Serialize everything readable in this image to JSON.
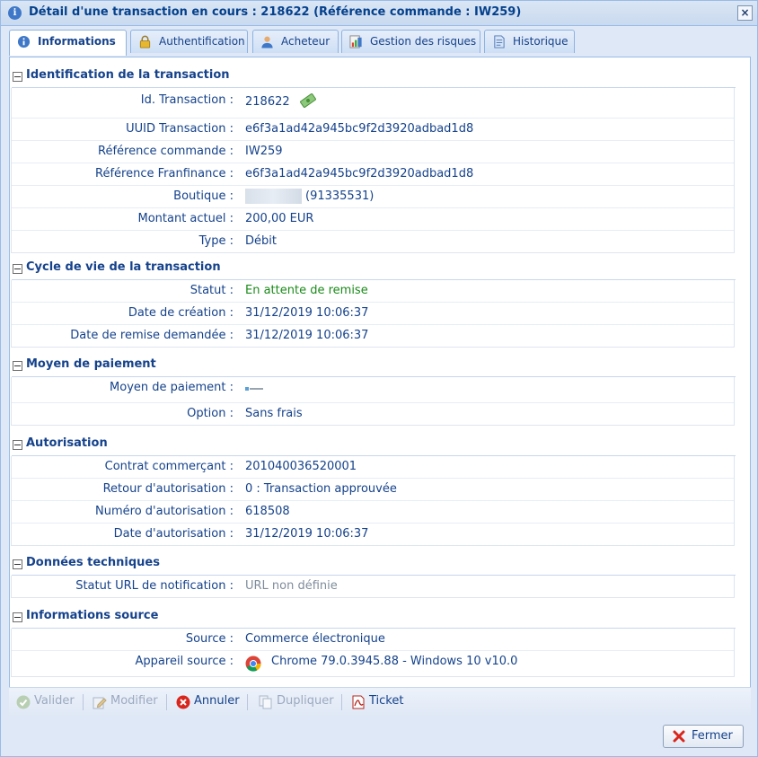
{
  "window": {
    "title": "Détail d'une transaction en cours : 218622 (Référence commande : IW259)",
    "close_symbol": "×"
  },
  "tabs": [
    {
      "label": "Informations",
      "active": true,
      "icon": "info-icon"
    },
    {
      "label": "Authentification",
      "active": false,
      "icon": "lock-icon"
    },
    {
      "label": "Acheteur",
      "active": false,
      "icon": "user-icon"
    },
    {
      "label": "Gestion des risques",
      "active": false,
      "icon": "risk-chart-icon"
    },
    {
      "label": "Historique",
      "active": false,
      "icon": "document-icon"
    }
  ],
  "sections": {
    "identification": {
      "title": "Identification de la transaction",
      "rows": [
        {
          "label": "Id. Transaction :",
          "value": "218622"
        },
        {
          "label": "UUID Transaction :",
          "value": "e6f3a1ad42a945bc9f2d3920adbad1d8"
        },
        {
          "label": "Référence commande :",
          "value": "IW259"
        },
        {
          "label": "Référence Franfinance :",
          "value": "e6f3a1ad42a945bc9f2d3920adbad1d8"
        },
        {
          "label": "Boutique :",
          "value": "(91335531)"
        },
        {
          "label": "Montant actuel :",
          "value": "200,00 EUR"
        },
        {
          "label": "Type :",
          "value": "Débit"
        }
      ]
    },
    "lifecycle": {
      "title": "Cycle de vie de la transaction",
      "rows": [
        {
          "label": "Statut :",
          "value": "En attente de remise"
        },
        {
          "label": "Date de création :",
          "value": "31/12/2019 10:06:37"
        },
        {
          "label": "Date de remise demandée :",
          "value": "31/12/2019 10:06:37"
        }
      ]
    },
    "payment": {
      "title": "Moyen de paiement",
      "rows": [
        {
          "label": "Moyen de paiement :",
          "value": ""
        },
        {
          "label": "Option :",
          "value": "Sans frais"
        }
      ]
    },
    "authorization": {
      "title": "Autorisation",
      "rows": [
        {
          "label": "Contrat commerçant :",
          "value": "201040036520001"
        },
        {
          "label": "Retour d'autorisation :",
          "value": "0 : Transaction approuvée"
        },
        {
          "label": "Numéro d'autorisation :",
          "value": "618508"
        },
        {
          "label": "Date d'autorisation :",
          "value": "31/12/2019 10:06:37"
        }
      ]
    },
    "technical": {
      "title": "Données techniques",
      "rows": [
        {
          "label": "Statut URL de notification :",
          "value": "URL non définie"
        }
      ]
    },
    "source": {
      "title": "Informations source",
      "rows": [
        {
          "label": "Source :",
          "value": "Commerce électronique"
        },
        {
          "label": "Appareil source :",
          "value": "Chrome 79.0.3945.88 - Windows 10 v10.0"
        }
      ]
    }
  },
  "toolbar": {
    "validate": "Valider",
    "modify": "Modifier",
    "cancel": "Annuler",
    "duplicate": "Dupliquer",
    "ticket": "Ticket"
  },
  "footer": {
    "close_label": "Fermer"
  },
  "colors": {
    "status_green": "#1a8a1a",
    "label_blue": "#15428b",
    "frame_blue": "#99bbe8"
  }
}
